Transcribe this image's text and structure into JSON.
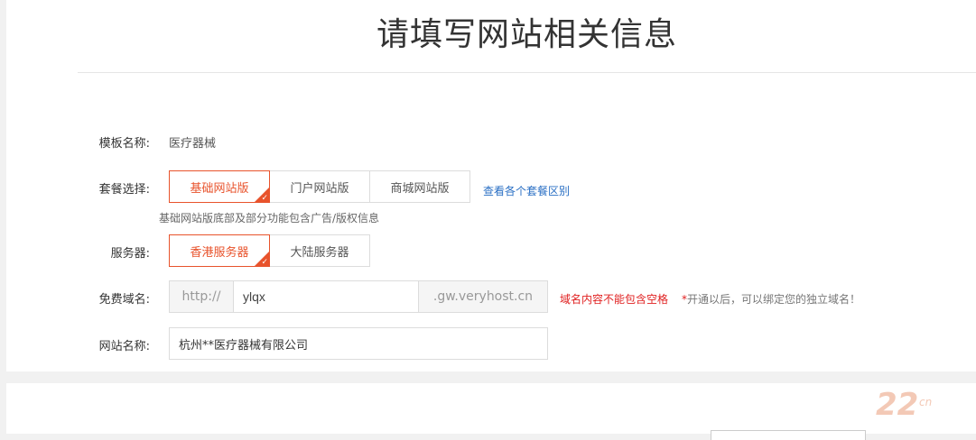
{
  "header": {
    "title": "请填写网站相关信息"
  },
  "form": {
    "template": {
      "label": "模板名称:",
      "value": "医疗器械"
    },
    "package": {
      "label": "套餐选择:",
      "options": [
        "基础网站版",
        "门户网站版",
        "商城网站版"
      ],
      "selected": "基础网站版",
      "compare_link": "查看各个套餐区别",
      "hint": "基础网站版底部及部分功能包含广告/版权信息"
    },
    "server": {
      "label": "服务器:",
      "options": [
        "香港服务器",
        "大陆服务器"
      ],
      "selected": "香港服务器"
    },
    "domain": {
      "label": "免费域名:",
      "prefix": "http://",
      "value": "ylqx",
      "suffix": ".gw.veryhost.cn",
      "error": "域名内容不能包含空格",
      "note_star": "*",
      "note": "开通以后，可以绑定您的独立域名！"
    },
    "site_name": {
      "label": "网站名称:",
      "value": "杭州**医疗器械有限公司"
    }
  },
  "watermark": {
    "text": "22",
    "sub": "cn"
  },
  "colors": {
    "accent": "#e8532c",
    "link": "#2a6fc4",
    "error": "#e02020"
  }
}
